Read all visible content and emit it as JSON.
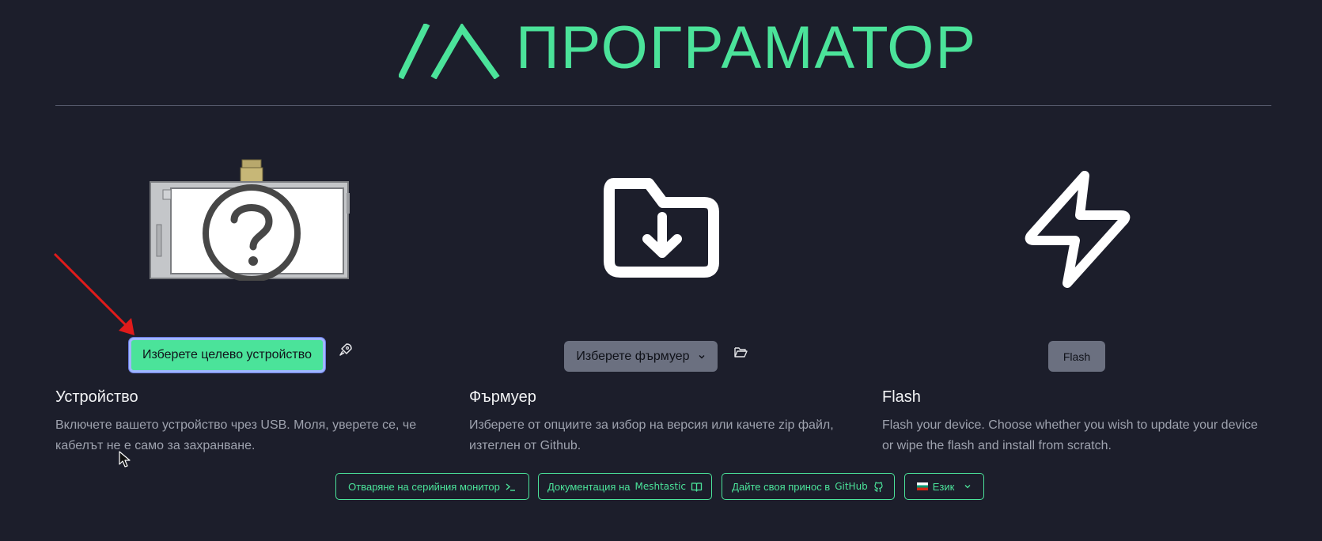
{
  "header": {
    "title": "ПРОГРАМАТОР"
  },
  "device": {
    "button_label": "Изберете целево устройство",
    "title": "Устройство",
    "description": "Включете вашето устройство чрез USB. Моля, уверете се, че кабелът не е само за захранване."
  },
  "firmware": {
    "button_label": "Изберете фърмуер",
    "title": "Фърмуер",
    "description": "Изберете от опциите за избор на версия или качете zip файл, изтеглен от Github."
  },
  "flash": {
    "button_label": "Flash",
    "title": "Flash",
    "description": "Flash your device. Choose whether you wish to update your device or wipe the flash and install from scratch."
  },
  "footer": {
    "serial_monitor": "Отваряне на серийния монитор",
    "docs": "Документация на",
    "docs_brand": "Meshtastic",
    "contribute": "Дайте своя принос в",
    "contribute_brand": "GitHub",
    "language": "Език"
  },
  "colors": {
    "accent": "#4be39a",
    "background": "#1c1e2b",
    "button_gray": "#6b7080",
    "annotation_arrow": "#e01b1b"
  },
  "icons": {
    "logo": "meshtastic-logo-icon",
    "device": "unknown-device-icon",
    "firmware": "folder-download-icon",
    "flash": "lightning-bolt-icon",
    "rocket": "rocket-icon",
    "folder": "folder-open-icon",
    "terminal": "terminal-icon",
    "book": "book-icon",
    "github": "github-icon",
    "chevron": "chevron-down-icon"
  }
}
